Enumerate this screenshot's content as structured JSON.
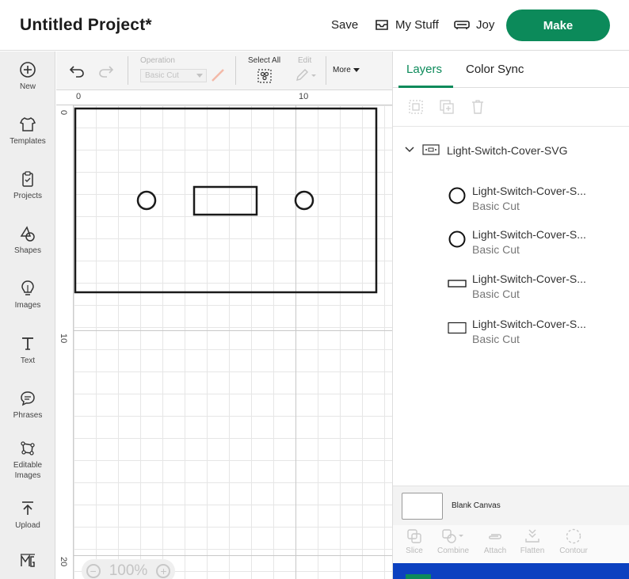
{
  "header": {
    "project_title": "Untitled Project*",
    "save_label": "Save",
    "my_stuff_label": "My Stuff",
    "machine_label": "Joy",
    "make_label": "Make"
  },
  "sidebar": {
    "items": [
      {
        "label": "New",
        "icon": "plus-circle-icon"
      },
      {
        "label": "Templates",
        "icon": "shirt-icon"
      },
      {
        "label": "Projects",
        "icon": "clipboard-icon"
      },
      {
        "label": "Shapes",
        "icon": "shapes-icon"
      },
      {
        "label": "Images",
        "icon": "lightbulb-icon"
      },
      {
        "label": "Text",
        "icon": "text-icon"
      },
      {
        "label": "Phrases",
        "icon": "speech-bubble-icon"
      },
      {
        "label": "Editable Images",
        "icon": "editable-image-icon"
      },
      {
        "label": "Upload",
        "icon": "upload-icon"
      }
    ]
  },
  "toolbar": {
    "operation_label": "Operation",
    "operation_value": "Basic Cut",
    "select_all_label": "Select All",
    "edit_label": "Edit",
    "more_label": "More"
  },
  "canvas": {
    "ruler_top": [
      "0",
      "10"
    ],
    "ruler_left": [
      "0",
      "10",
      "20"
    ],
    "zoom_level": "100%"
  },
  "panel": {
    "tabs": [
      {
        "label": "Layers",
        "active": true
      },
      {
        "label": "Color Sync",
        "active": false
      }
    ],
    "group_name": "Light-Switch-Cover-SVG",
    "layers": [
      {
        "name": "Light-Switch-Cover-S...",
        "operation": "Basic Cut",
        "shape": "circle"
      },
      {
        "name": "Light-Switch-Cover-S...",
        "operation": "Basic Cut",
        "shape": "circle"
      },
      {
        "name": "Light-Switch-Cover-S...",
        "operation": "Basic Cut",
        "shape": "slot"
      },
      {
        "name": "Light-Switch-Cover-S...",
        "operation": "Basic Cut",
        "shape": "rectangle"
      }
    ],
    "blank_canvas_label": "Blank Canvas",
    "actions": [
      {
        "label": "Slice",
        "icon": "slice-icon"
      },
      {
        "label": "Combine",
        "icon": "combine-icon"
      },
      {
        "label": "Attach",
        "icon": "attach-icon"
      },
      {
        "label": "Flatten",
        "icon": "flatten-icon"
      },
      {
        "label": "Contour",
        "icon": "contour-icon"
      }
    ]
  },
  "colors": {
    "accent_green": "#0c8a5a",
    "bottom_bar_blue": "#0c41c0"
  }
}
